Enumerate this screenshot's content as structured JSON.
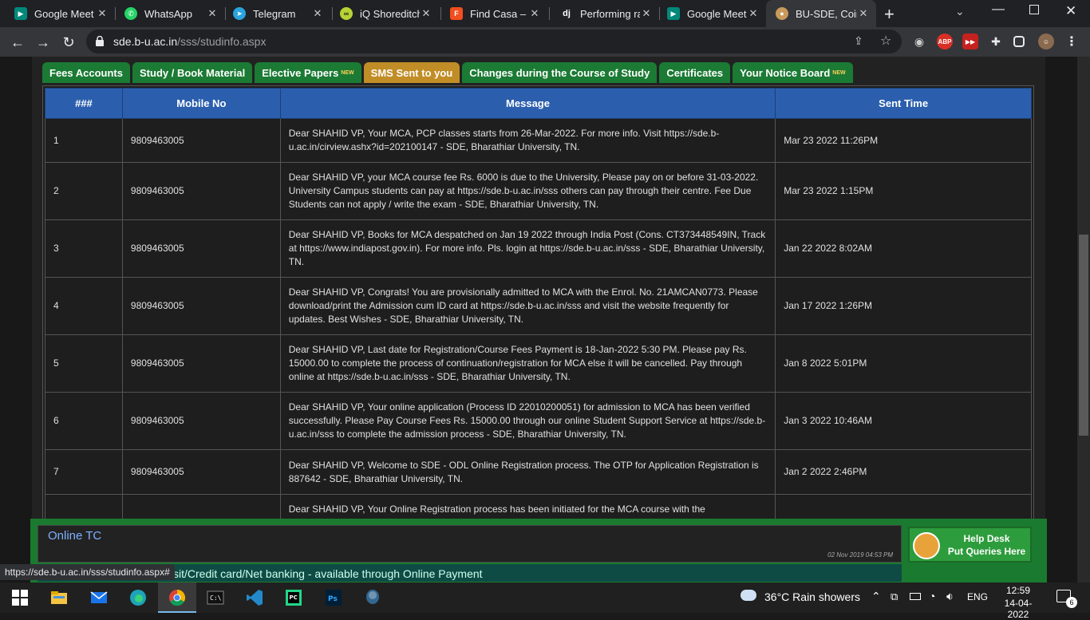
{
  "browser": {
    "tabs": [
      {
        "title": "Google Meet",
        "favicon": "google-meet-icon",
        "color": "#00897b"
      },
      {
        "title": "WhatsApp",
        "favicon": "whatsapp-icon",
        "color": "#25d366"
      },
      {
        "title": "Telegram",
        "favicon": "telegram-icon",
        "color": "#2aa3de"
      },
      {
        "title": "iQ Shoreditch",
        "favicon": "iq-icon",
        "color": "#b5d334"
      },
      {
        "title": "Find Casa – Fi",
        "favicon": "figma-icon",
        "color": "#f24e1e"
      },
      {
        "title": "Performing ra",
        "favicon": "django-icon",
        "color": "#0c4b33"
      },
      {
        "title": "Google Meet",
        "favicon": "google-meet-icon",
        "color": "#00897b"
      },
      {
        "title": "BU-SDE, Coim",
        "favicon": "person-icon",
        "color": "#c99a5b"
      }
    ],
    "url_host": "sde.b-u.ac.in",
    "url_path": "/sss/studinfo.aspx",
    "status_url": "https://sde.b-u.ac.in/sss/studinfo.aspx#"
  },
  "nav": {
    "tabs": [
      {
        "label": "Fees Accounts",
        "new": ""
      },
      {
        "label": "Study / Book Material",
        "new": ""
      },
      {
        "label": "Elective Papers",
        "new": "NEW"
      },
      {
        "label": "SMS Sent to you",
        "new": ""
      },
      {
        "label": "Changes during the Course of Study",
        "new": ""
      },
      {
        "label": "Certificates",
        "new": ""
      },
      {
        "label": "Your Notice Board",
        "new": "NEW"
      }
    ],
    "active_index": 3
  },
  "table": {
    "headers": [
      "###",
      "Mobile No",
      "Message",
      "Sent Time"
    ],
    "rows": [
      {
        "no": "1",
        "mobile": "9809463005",
        "message": "Dear SHAHID VP, Your MCA, PCP classes starts from 26-Mar-2022. For more info. Visit https://sde.b-u.ac.in/cirview.ashx?id=202100147 - SDE, Bharathiar University, TN.",
        "time": "Mar 23 2022 11:26PM"
      },
      {
        "no": "2",
        "mobile": "9809463005",
        "message": "Dear SHAHID VP, your MCA course fee Rs. 6000 is due to the University, Please pay on or before 31-03-2022. University Campus students can pay at https://sde.b-u.ac.in/sss others can pay through their centre. Fee Due Students can not apply / write the exam - SDE, Bharathiar University, TN.",
        "time": "Mar 23 2022 1:15PM"
      },
      {
        "no": "3",
        "mobile": "9809463005",
        "message": "Dear SHAHID VP, Books for MCA despatched on Jan 19 2022 through India Post (Cons. CT373448549IN, Track at https://www.indiapost.gov.in). For more info. Pls. login at https://sde.b-u.ac.in/sss - SDE, Bharathiar University, TN.",
        "time": "Jan 22 2022 8:02AM"
      },
      {
        "no": "4",
        "mobile": "9809463005",
        "message": "Dear SHAHID VP, Congrats! You are provisionally admitted to MCA with the Enrol. No. 21AMCAN0773. Please download/print the Admission cum ID card at https://sde.b-u.ac.in/sss and visit the website frequently for updates. Best Wishes - SDE, Bharathiar University, TN.",
        "time": "Jan 17 2022 1:26PM"
      },
      {
        "no": "5",
        "mobile": "9809463005",
        "message": "Dear SHAHID VP, Last date for Registration/Course Fees Payment is 18-Jan-2022 5:30 PM. Please pay Rs. 15000.00 to complete the process of continuation/registration for MCA else it will be cancelled. Pay through online at https://sde.b-u.ac.in/sss - SDE, Bharathiar University, TN.",
        "time": "Jan 8 2022 5:01PM"
      },
      {
        "no": "6",
        "mobile": "9809463005",
        "message": "Dear SHAHID VP, Your online application (Process ID 22010200051) for admission to MCA has been verified successfully. Please Pay Course Fees Rs. 15000.00 through our online Student Support Service at https://sde.b-u.ac.in/sss to complete the admission process - SDE, Bharathiar University, TN.",
        "time": "Jan 3 2022 10:46AM"
      },
      {
        "no": "7",
        "mobile": "9809463005",
        "message": "Dear SHAHID VP, Welcome to SDE - ODL Online Registration process. The OTP for Application Registration is 887642 - SDE, Bharathiar University, TN.",
        "time": "Jan 2 2022 2:46PM"
      },
      {
        "no": "",
        "mobile": "",
        "message": "Dear SHAHID VP, Your Online Registration process has been initiated for the MCA course with the",
        "time": ""
      }
    ]
  },
  "footer": {
    "online_tc_title": "Online TC",
    "online_tc_date": "02 Nov 2019 04:53 PM",
    "marquee_text": "sit/Credit card/Net banking - available through Online Payment",
    "help_line1": "Help Desk",
    "help_line2": "Put Queries Here"
  },
  "taskbar": {
    "weather": "36°C  Rain showers",
    "lang": "ENG",
    "time": "12:59",
    "date": "14-04-2022",
    "notifications": "6"
  },
  "colors": {
    "nav_green": "#1b7a34",
    "nav_active": "#c18d26",
    "header_blue": "#2b5fad"
  }
}
